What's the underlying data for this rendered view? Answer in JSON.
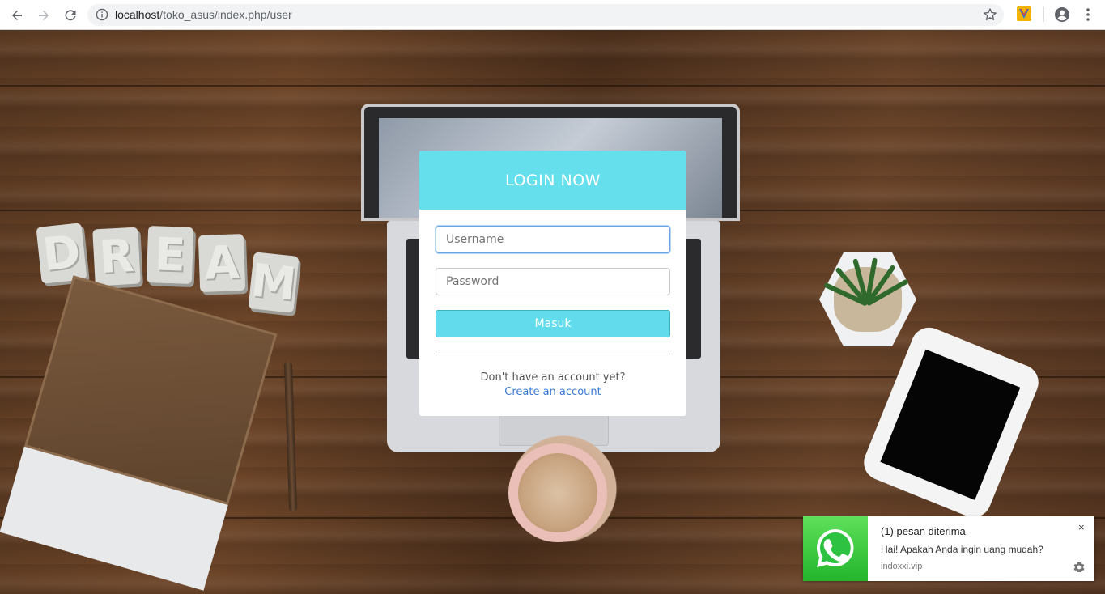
{
  "browser": {
    "url_host": "localhost",
    "url_path": "/toko_asus/index.php/user"
  },
  "login": {
    "title": "LOGIN NOW",
    "username_placeholder": "Username",
    "password_placeholder": "Password",
    "submit_label": "Masuk",
    "no_account_text": "Don't have an account yet?",
    "create_account_link": "Create an account",
    "header_color": "#66dfed",
    "button_color": "#62dced"
  },
  "notification": {
    "title": "(1) pesan diterima",
    "message": "Hai! Apakah Anda ingin uang mudah?",
    "source": "indoxxi.vip",
    "close_label": "×",
    "icon": "whatsapp-icon"
  },
  "scene": {
    "dream_letters": [
      "D",
      "R",
      "E",
      "A",
      "M"
    ]
  }
}
